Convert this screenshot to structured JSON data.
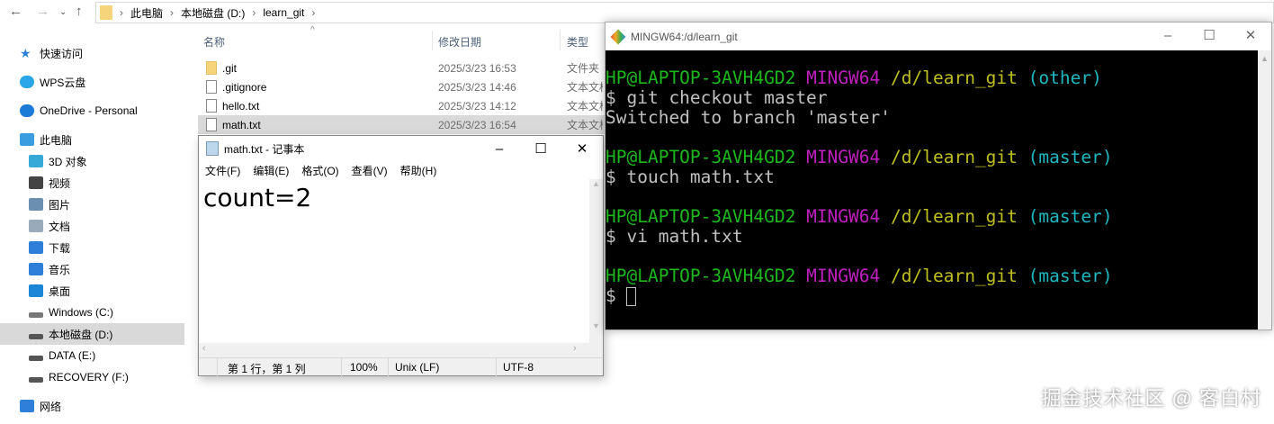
{
  "explorer": {
    "breadcrumb": [
      "此电脑",
      "本地磁盘 (D:)",
      "learn_git"
    ],
    "sidebar": [
      {
        "label": "快速访问",
        "icon": "star-icon",
        "color": "#2d7fd8"
      },
      {
        "label": "WPS云盘",
        "icon": "cloud-icon",
        "color": "#2aa7e8"
      },
      {
        "label": "OneDrive - Personal",
        "icon": "onedrive-icon",
        "color": "#1c7bd6"
      },
      {
        "label": "此电脑",
        "icon": "computer-icon",
        "color": "#3a9de0"
      },
      {
        "label": "3D 对象",
        "icon": "cube-icon",
        "color": "#37a9d9"
      },
      {
        "label": "视频",
        "icon": "video-icon",
        "color": "#444"
      },
      {
        "label": "图片",
        "icon": "picture-icon",
        "color": "#6b8fb0"
      },
      {
        "label": "文档",
        "icon": "document-icon",
        "color": "#9ab"
      },
      {
        "label": "下载",
        "icon": "download-icon",
        "color": "#2d7fd8"
      },
      {
        "label": "音乐",
        "icon": "music-icon",
        "color": "#2d7fd8"
      },
      {
        "label": "桌面",
        "icon": "desktop-icon",
        "color": "#1c86d6"
      },
      {
        "label": "Windows (C:)",
        "icon": "drive-icon",
        "color": "#777"
      },
      {
        "label": "本地磁盘 (D:)",
        "icon": "drive-icon",
        "color": "#555"
      },
      {
        "label": "DATA (E:)",
        "icon": "drive-icon",
        "color": "#555"
      },
      {
        "label": "RECOVERY (F:)",
        "icon": "drive-icon",
        "color": "#555"
      },
      {
        "label": "网络",
        "icon": "network-icon",
        "color": "#2d7fd8"
      }
    ],
    "columns": {
      "name": "名称",
      "date": "修改日期",
      "type": "类型"
    },
    "files": [
      {
        "name": ".git",
        "date": "2025/3/23 16:53",
        "type": "文件夹"
      },
      {
        "name": ".gitignore",
        "date": "2025/3/23 14:46",
        "type": "文本文档"
      },
      {
        "name": "hello.txt",
        "date": "2025/3/23 14:12",
        "type": "文本文档"
      },
      {
        "name": "math.txt",
        "date": "2025/3/23 16:54",
        "type": "文本文档"
      }
    ]
  },
  "notepad": {
    "title": "math.txt - 记事本",
    "menu": [
      "文件(F)",
      "编辑(E)",
      "格式(O)",
      "查看(V)",
      "帮助(H)"
    ],
    "content": "count=2",
    "status": {
      "position": "第 1 行，第 1 列",
      "zoom": "100%",
      "eol": "Unix (LF)",
      "encoding": "UTF-8"
    }
  },
  "terminal": {
    "title": "MINGW64:/d/learn_git",
    "user": "HP@LAPTOP-3AVH4GD2",
    "env": "MINGW64",
    "path": "/d/learn_git",
    "blocks": [
      {
        "branch": "(other)",
        "cmd": "$ git checkout master",
        "out": "Switched to branch 'master'"
      },
      {
        "branch": "(master)",
        "cmd": "$ touch math.txt"
      },
      {
        "branch": "(master)",
        "cmd": "$ vi math.txt"
      },
      {
        "branch": "(master)",
        "prompt": "$ "
      }
    ]
  },
  "watermark": "掘金技术社区 @ 客白村"
}
